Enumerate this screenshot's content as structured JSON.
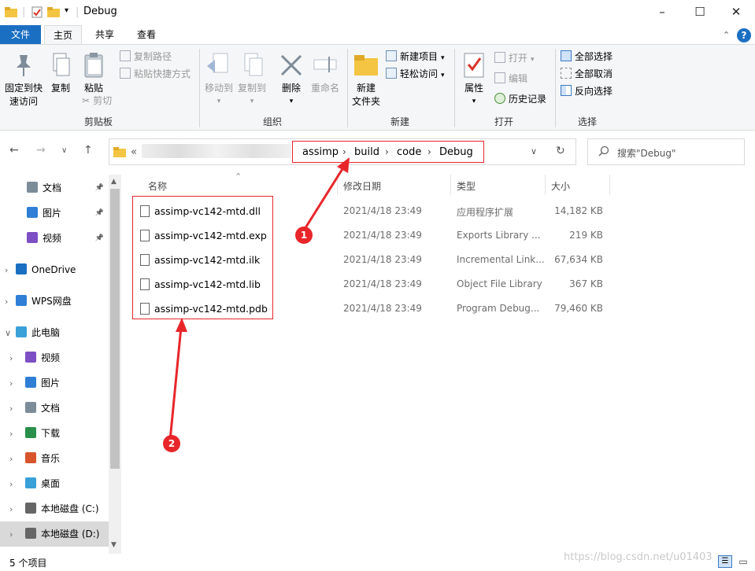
{
  "window": {
    "title": "Debug",
    "minimize": "–",
    "maximize": "☐",
    "close": "✕"
  },
  "ribbon_tabs": [
    "文件",
    "主页",
    "共享",
    "查看"
  ],
  "ribbon": {
    "clipboard": {
      "pin": "固定到快\n速访问",
      "copy": "复制",
      "paste": "粘贴",
      "copy_path": "复制路径",
      "paste_shortcut": "粘贴快捷方式",
      "cut": "剪切",
      "label": "剪贴板"
    },
    "organize": {
      "move_to": "移动到",
      "copy_to": "复制到",
      "delete": "删除",
      "rename": "重命名",
      "label": "组织"
    },
    "new": {
      "new_folder": "新建\n文件夹",
      "new_item": "新建项目",
      "easy_access": "轻松访问",
      "label": "新建"
    },
    "open": {
      "properties": "属性",
      "open": "打开",
      "edit": "编辑",
      "history": "历史记录",
      "label": "打开"
    },
    "select": {
      "select_all": "全部选择",
      "select_none": "全部取消",
      "invert": "反向选择",
      "label": "选择"
    }
  },
  "address": {
    "prefix": "«",
    "crumbs": [
      "assimp",
      "build",
      "code",
      "Debug"
    ],
    "search_placeholder": "搜索\"Debug\""
  },
  "nav_pane": [
    {
      "label": "文档",
      "level": "quick",
      "pinned": true,
      "icon": "document-icon"
    },
    {
      "label": "图片",
      "level": "quick",
      "pinned": true,
      "icon": "picture-icon"
    },
    {
      "label": "视频",
      "level": "quick",
      "pinned": true,
      "icon": "video-icon"
    },
    {
      "label": "OneDrive",
      "level": "root",
      "icon": "onedrive-icon"
    },
    {
      "label": "WPS网盘",
      "level": "root",
      "icon": "wps-cloud-icon"
    },
    {
      "label": "此电脑",
      "level": "root-open",
      "icon": "computer-icon"
    },
    {
      "label": "视频",
      "level": "child",
      "icon": "video-icon"
    },
    {
      "label": "图片",
      "level": "child",
      "icon": "picture-icon"
    },
    {
      "label": "文档",
      "level": "child",
      "icon": "document-icon"
    },
    {
      "label": "下载",
      "level": "child",
      "icon": "download-icon"
    },
    {
      "label": "音乐",
      "level": "child",
      "icon": "music-icon"
    },
    {
      "label": "桌面",
      "level": "child",
      "icon": "desktop-icon"
    },
    {
      "label": "本地磁盘 (C:)",
      "level": "child",
      "icon": "drive-icon"
    },
    {
      "label": "本地磁盘 (D:)",
      "level": "child",
      "icon": "drive-icon",
      "selected": true
    }
  ],
  "columns": [
    "名称",
    "修改日期",
    "类型",
    "大小"
  ],
  "files": [
    {
      "name": "assimp-vc142-mtd.dll",
      "date": "2021/4/18 23:49",
      "type": "应用程序扩展",
      "size": "14,182 KB",
      "icon": "dll-file-icon"
    },
    {
      "name": "assimp-vc142-mtd.exp",
      "date": "2021/4/18 23:49",
      "type": "Exports Library ...",
      "size": "219 KB",
      "icon": "exp-file-icon"
    },
    {
      "name": "assimp-vc142-mtd.ilk",
      "date": "2021/4/18 23:49",
      "type": "Incremental Link...",
      "size": "67,634 KB",
      "icon": "ilk-file-icon"
    },
    {
      "name": "assimp-vc142-mtd.lib",
      "date": "2021/4/18 23:49",
      "type": "Object File Library",
      "size": "367 KB",
      "icon": "lib-file-icon"
    },
    {
      "name": "assimp-vc142-mtd.pdb",
      "date": "2021/4/18 23:49",
      "type": "Program Debug...",
      "size": "79,460 KB",
      "icon": "pdb-file-icon"
    }
  ],
  "annotations": [
    "1",
    "2"
  ],
  "status": {
    "count": "5 个项目",
    "watermark": "https://blog.csdn.net/u01403"
  },
  "colors": {
    "accent": "#1a6fc2",
    "annotation_red": "#e8262a",
    "selected_nav": "#cce8ff"
  }
}
